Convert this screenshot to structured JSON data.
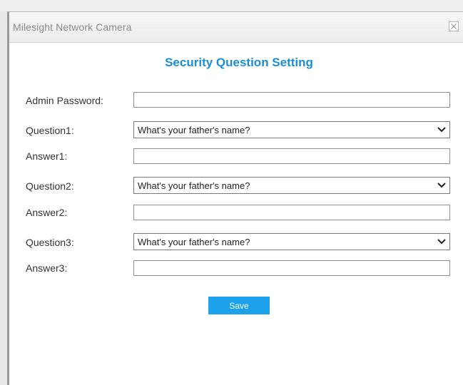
{
  "window": {
    "title": "Milesight Network Camera",
    "close_icon": "close-icon"
  },
  "form": {
    "heading": "Security Question Setting",
    "admin_password": {
      "label": "Admin Password:",
      "value": ""
    },
    "questions": [
      {
        "label": "Question1:",
        "selected": "What's your father's name?",
        "answer_label": "Answer1:",
        "answer_value": ""
      },
      {
        "label": "Question2:",
        "selected": "What's your father's name?",
        "answer_label": "Answer2:",
        "answer_value": ""
      },
      {
        "label": "Question3:",
        "selected": "What's your father's name?",
        "answer_label": "Answer3:",
        "answer_value": ""
      }
    ],
    "save_label": "Save"
  },
  "colors": {
    "heading": "#1a8ed5",
    "save_button": "#1ca1ea",
    "title_text": "#8a8a8a"
  }
}
